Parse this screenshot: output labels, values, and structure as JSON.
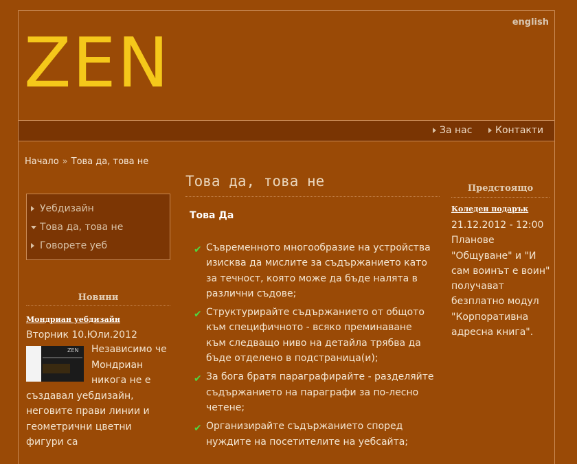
{
  "header": {
    "lang_link": "english",
    "logo_text": "ZEN"
  },
  "nav": {
    "items": [
      {
        "label": "За нас"
      },
      {
        "label": "Контакти"
      }
    ]
  },
  "breadcrumb": {
    "home": "Начало",
    "separator": "»",
    "current": "Това да, това не"
  },
  "sidebar": {
    "subnav": [
      {
        "label": "Уебдизайн",
        "state": "collapsed"
      },
      {
        "label": "Това да, това не",
        "state": "expanded"
      },
      {
        "label": "Говорете уеб",
        "state": "collapsed"
      }
    ],
    "news": {
      "heading": "Новини",
      "item_title": "Мондриан уебдизайн",
      "item_date": "Вторник 10.Юли.2012",
      "item_text": "Независимо че Мондриан никога не е създавал уебдизайн, неговите прави линии и геометрични цветни фигури са",
      "thumb_label": "ZEN"
    }
  },
  "main": {
    "title": "Това да, това не",
    "section_title": "Това Да",
    "items": [
      "Съвременното многообразие на устройства изисква да мислите за съдържанието като за течност, която може да бъде налята в различни съдове;",
      "Структурирайте съдържанието от общото към специфичното - всяко преминаване към следващо ниво на детайла трябва да бъде отделено в подстраница(и);",
      "За бога братя параграфирайте - разделяйте съдържанието на параграфи за по-лесно четене;",
      "Организирайте съдържанието според нуждите на посетителите на уебсайта;"
    ]
  },
  "upcoming": {
    "heading": "Предстоящо",
    "item_title": "Коледен подарък",
    "item_datetime": "21.12.2012 - 12:00",
    "item_text": "Планове \"Общуване\" и \"И сам воинът е воин\" получават безплатно модул \"Корпоративна адресна книга\"."
  },
  "colors": {
    "background": "#9a4a06",
    "navbar": "#7a3503",
    "logo": "#f5c81a",
    "check": "#4fd640"
  }
}
